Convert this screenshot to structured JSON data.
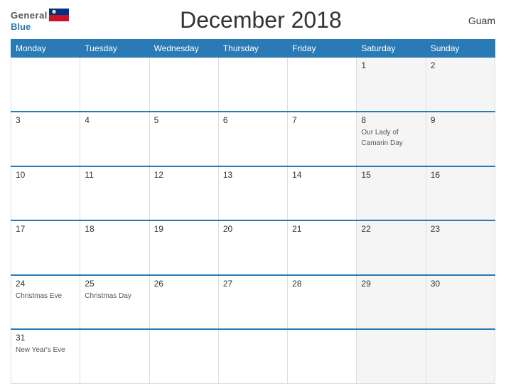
{
  "header": {
    "logo_general": "General",
    "logo_blue": "Blue",
    "title": "December 2018",
    "region": "Guam"
  },
  "days_of_week": [
    "Monday",
    "Tuesday",
    "Wednesday",
    "Thursday",
    "Friday",
    "Saturday",
    "Sunday"
  ],
  "weeks": [
    [
      {
        "day": "",
        "event": "",
        "weekend": false
      },
      {
        "day": "",
        "event": "",
        "weekend": false
      },
      {
        "day": "",
        "event": "",
        "weekend": false
      },
      {
        "day": "",
        "event": "",
        "weekend": false
      },
      {
        "day": "",
        "event": "",
        "weekend": false
      },
      {
        "day": "1",
        "event": "",
        "weekend": true
      },
      {
        "day": "2",
        "event": "",
        "weekend": true
      }
    ],
    [
      {
        "day": "3",
        "event": "",
        "weekend": false
      },
      {
        "day": "4",
        "event": "",
        "weekend": false
      },
      {
        "day": "5",
        "event": "",
        "weekend": false
      },
      {
        "day": "6",
        "event": "",
        "weekend": false
      },
      {
        "day": "7",
        "event": "",
        "weekend": false
      },
      {
        "day": "8",
        "event": "Our Lady of Camarin Day",
        "weekend": true
      },
      {
        "day": "9",
        "event": "",
        "weekend": true
      }
    ],
    [
      {
        "day": "10",
        "event": "",
        "weekend": false
      },
      {
        "day": "11",
        "event": "",
        "weekend": false
      },
      {
        "day": "12",
        "event": "",
        "weekend": false
      },
      {
        "day": "13",
        "event": "",
        "weekend": false
      },
      {
        "day": "14",
        "event": "",
        "weekend": false
      },
      {
        "day": "15",
        "event": "",
        "weekend": true
      },
      {
        "day": "16",
        "event": "",
        "weekend": true
      }
    ],
    [
      {
        "day": "17",
        "event": "",
        "weekend": false
      },
      {
        "day": "18",
        "event": "",
        "weekend": false
      },
      {
        "day": "19",
        "event": "",
        "weekend": false
      },
      {
        "day": "20",
        "event": "",
        "weekend": false
      },
      {
        "day": "21",
        "event": "",
        "weekend": false
      },
      {
        "day": "22",
        "event": "",
        "weekend": true
      },
      {
        "day": "23",
        "event": "",
        "weekend": true
      }
    ],
    [
      {
        "day": "24",
        "event": "Christmas Eve",
        "weekend": false
      },
      {
        "day": "25",
        "event": "Christmas Day",
        "weekend": false
      },
      {
        "day": "26",
        "event": "",
        "weekend": false
      },
      {
        "day": "27",
        "event": "",
        "weekend": false
      },
      {
        "day": "28",
        "event": "",
        "weekend": false
      },
      {
        "day": "29",
        "event": "",
        "weekend": true
      },
      {
        "day": "30",
        "event": "",
        "weekend": true
      }
    ],
    [
      {
        "day": "31",
        "event": "New Year's Eve",
        "weekend": false
      },
      {
        "day": "",
        "event": "",
        "weekend": false
      },
      {
        "day": "",
        "event": "",
        "weekend": false
      },
      {
        "day": "",
        "event": "",
        "weekend": false
      },
      {
        "day": "",
        "event": "",
        "weekend": false
      },
      {
        "day": "",
        "event": "",
        "weekend": true
      },
      {
        "day": "",
        "event": "",
        "weekend": true
      }
    ]
  ]
}
